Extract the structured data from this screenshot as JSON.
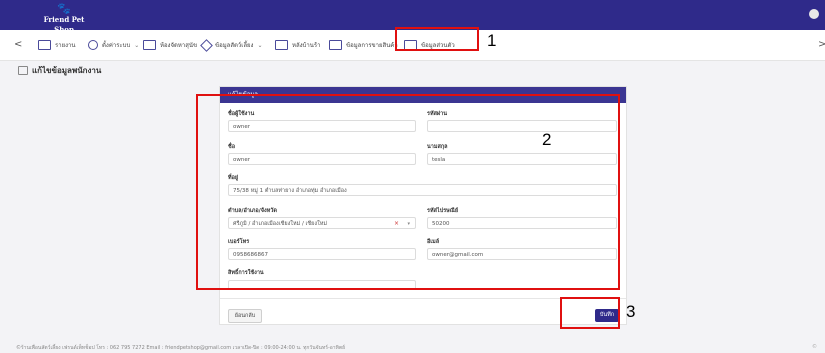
{
  "header": {
    "brand": "Friend Pet Shop",
    "logo_mark": "🐾"
  },
  "nav": {
    "back_arrow": "<",
    "forward_arrow": ">",
    "items": [
      {
        "label": "รายงาน",
        "icon": "report-icon"
      },
      {
        "label": "ตั้งค่าระบบ",
        "icon": "gear-icon"
      },
      {
        "label": "ห้องจัดหาสุนัข",
        "icon": "room-icon"
      },
      {
        "label": "ข้อมูลสัตว์เลี้ยง",
        "icon": "pet-icon"
      },
      {
        "label": "หลังบ้านร้า",
        "icon": "store-icon"
      },
      {
        "label": "ข้อมูลการขายสินค้า",
        "icon": "monitor-icon"
      },
      {
        "label": "ข้อมูลส่วนตัว",
        "icon": "profile-icon"
      }
    ]
  },
  "page": {
    "title": "แก้ไขข้อมูลพนักงาน"
  },
  "form": {
    "header": "แก้ไขข้อมูล",
    "username_label": "ชื่อผู้ใช้งาน",
    "username_value": "owner",
    "password_label": "รหัสผ่าน",
    "password_value": "",
    "firstname_label": "ชื่อ",
    "firstname_value": "owner",
    "lastname_label": "นามสกุล",
    "lastname_value": "tesla",
    "address_label": "ที่อยู่",
    "address_value": "75/38 หมู่ 1 ตำบลท่ายาง อำเภอทุ่ม อำเภอเมือง",
    "district_label": "ตำบล/อำเภอ/จังหวัด",
    "district_value": "ศรีภูมิ / อำเภอเมืองเชียงใหม่ / เชียงใหม่",
    "postcode_label": "รหัสไปรษณีย์",
    "postcode_value": "50200",
    "phone_label": "เบอร์โทร",
    "phone_value": "0958686867",
    "email_label": "อีเมล์",
    "email_value": "owner@gmail.com",
    "role_label": "สิทธิ์การใช้งาน",
    "back_button": "ย้อนกลับ",
    "save_button": "บันทึก"
  },
  "annotations": {
    "one": "1",
    "two": "2",
    "three": "3",
    "color": "#e01010"
  },
  "footer": {
    "text": "©ร้านเพื่อนสัตว์เลี้ยง เฟรนด์เพ็ทช็อป  โทร : 062 795 7272   Email : friendpetshop@gmail.com   เวลาเปิด-ปิด : 09:00-24:00 น. ทุกวันจันทร์-อาทิตย์",
    "right": "©"
  },
  "colors": {
    "topbar": "#2f2a8a",
    "card_header": "#3b3592",
    "save_button": "#2f2a8a"
  }
}
